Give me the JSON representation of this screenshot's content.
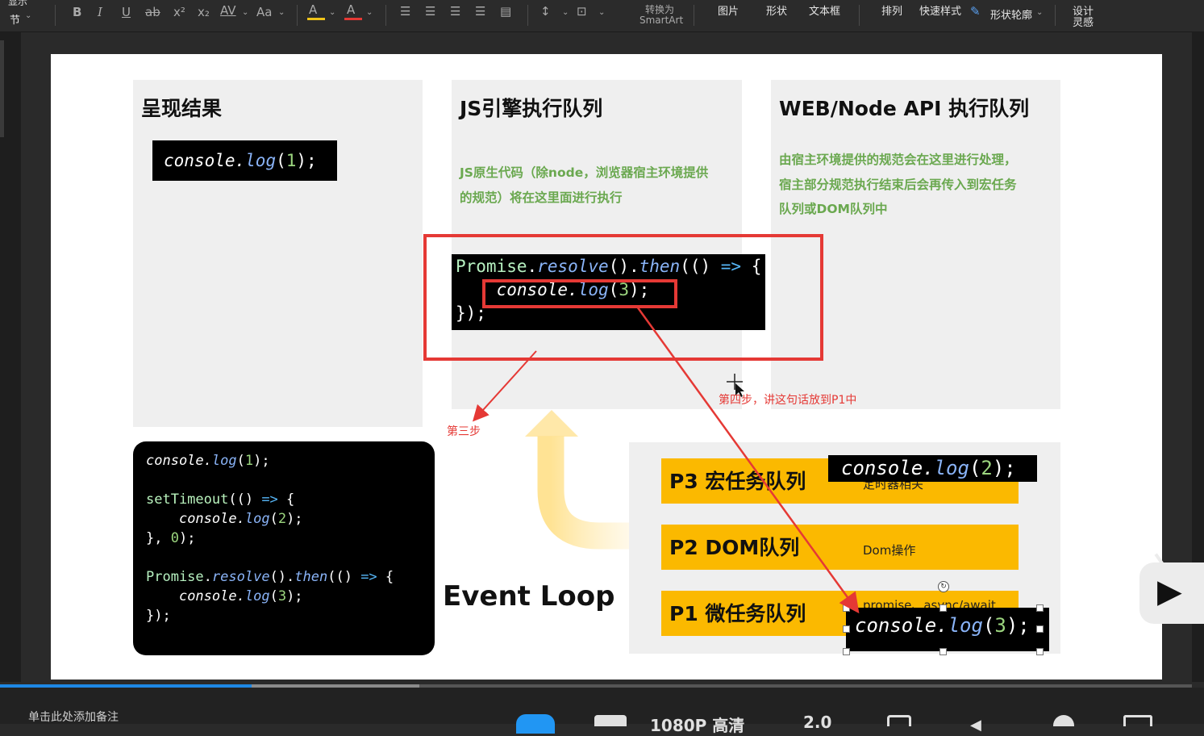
{
  "toolbar": {
    "left_top": "显示",
    "left_section": "节",
    "bold": "B",
    "italic": "I",
    "underline": "U",
    "strike": "ab",
    "superscript": "x²",
    "subscript": "x₂",
    "spacing": "AV",
    "case": "Aa",
    "highlight": "A",
    "fontcolor": "A",
    "convert_line1": "转换为",
    "convert_line2": "SmartArt",
    "picture": "图片",
    "shape": "形状",
    "textbox": "文本框",
    "arrange": "排列",
    "quick_styles": "快速样式",
    "shape_outline": "形状轮廓",
    "design_line1": "设计",
    "design_line2": "灵感",
    "highlight_color": "#f0c419",
    "fontcolor_color": "#e53935"
  },
  "slide": {
    "panel1_title": "呈现结果",
    "panel2_title": "JS引擎执行队列",
    "panel3_title": "WEB/Node API 执行队列",
    "panel2_desc_line1": "JS原生代码（除node，浏览器宿主环境提供",
    "panel2_desc_line2": "的规范）将在这里面进行执行",
    "panel3_desc_line1": "由宿主环境提供的规范会在这里进行处理，",
    "panel3_desc_line2": "宿主部分规范执行结束后会再传入到宏任务",
    "panel3_desc_line3": "队列或DOM队列中",
    "step3": "第三步",
    "step4": "第四步，讲这句话放到P1中",
    "event_loop": "Event Loop",
    "p3_label": "P3 宏任务队列",
    "p3_sub": "定时器相关",
    "p2_label": "P2 DOM队列",
    "p2_sub": "Dom操作",
    "p1_label": "P1 微任务队列",
    "p1_sub": "promise、async/await",
    "accent_red": "#e53935",
    "accent_green": "#6aa84f",
    "queue_color": "#fbb900"
  },
  "bottom": {
    "notes_placeholder": "单击此处添加备注",
    "quality": "1080P 高清",
    "speed": "2.0"
  }
}
